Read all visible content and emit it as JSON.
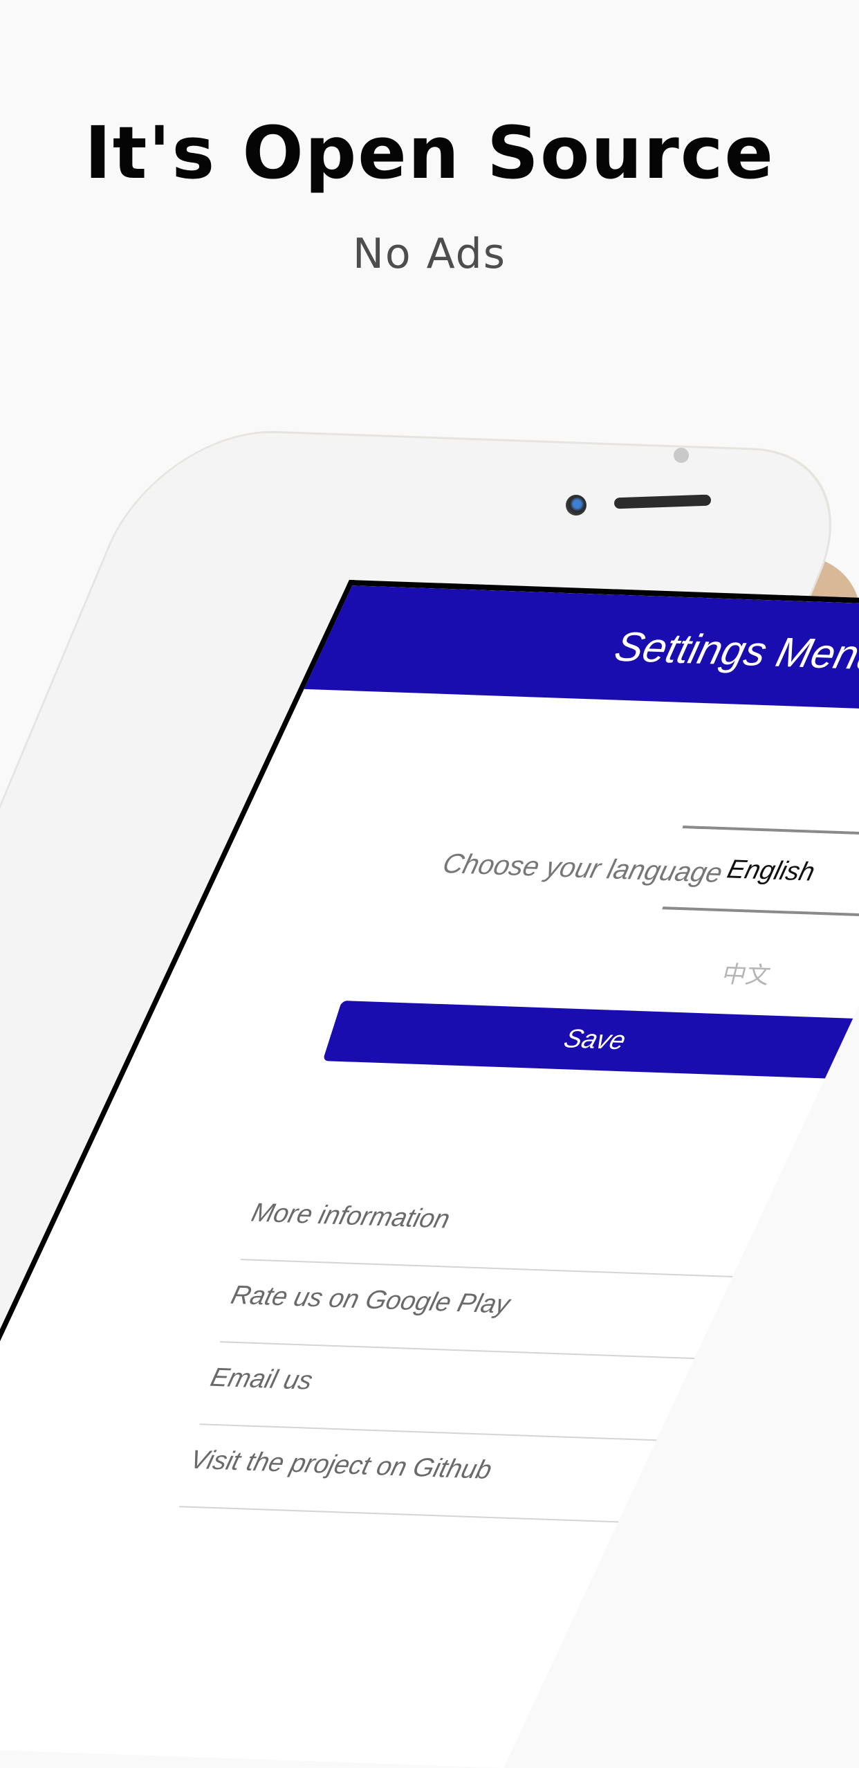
{
  "promo": {
    "headline": "It's Open Source",
    "subline": "No Ads"
  },
  "screen": {
    "nav_title": "Settings Menu",
    "language_label": "Choose your language",
    "language_options": [
      "English",
      "中文"
    ],
    "selected_language": "English",
    "save_label": "Save",
    "links": [
      {
        "label": "More information",
        "icon": "none"
      },
      {
        "label": "Rate us on Google Play",
        "icon": "chevron-right-icon"
      },
      {
        "label": "Email us",
        "icon": "chevron-right-icon"
      },
      {
        "label": "Visit the project on Github",
        "icon": "chevron-right-icon"
      }
    ]
  },
  "colors": {
    "accent": "#1a0db0",
    "background": "#f9f9f9",
    "device_gold": "#d9b897"
  }
}
